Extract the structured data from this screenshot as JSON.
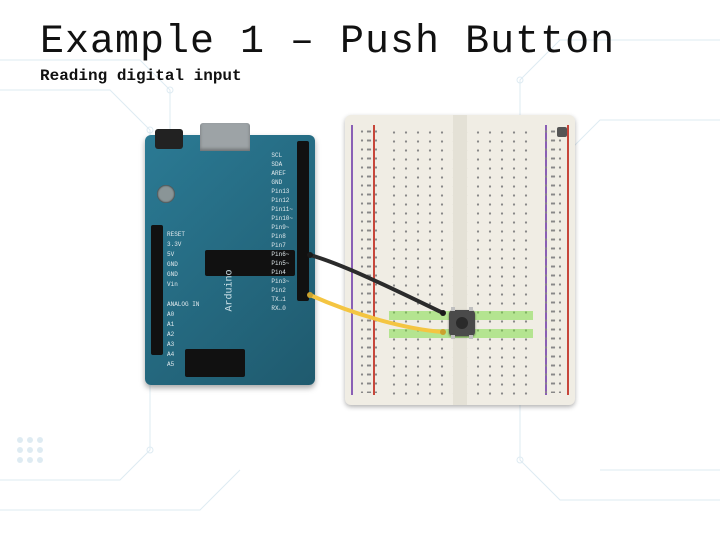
{
  "slide": {
    "title": "Example 1 – Push Button",
    "subtitle": "Reading digital input"
  },
  "arduino": {
    "logo_text": "Arduino",
    "pin_labels_right": "SCL\nSDA\nAREF\nGND\nPin13\nPin12\nPin11~\nPin10~\nPin9~\nPin8\nPin7\nPin6~\nPin5~\nPin4\nPin3~\nPin2\nTX→1\nRX←0",
    "pin_labels_left": "RESET\n3.3V\n5V\nGND\nGND\nVin\n\nANALOG IN\nA0\nA1\nA2\nA3\nA4\nA5"
  },
  "components": {
    "push_button_name": "push-button",
    "breadboard_name": "breadboard",
    "arduino_name": "arduino-uno"
  },
  "wires": [
    {
      "name": "digital-pin-to-button",
      "color": "#2b2b2b",
      "from": "arduino-pin5",
      "to": "breadboard-row-button-top"
    },
    {
      "name": "gnd-to-button",
      "color": "#f4c542",
      "from": "arduino-gnd",
      "to": "breadboard-row-button-bottom"
    }
  ]
}
